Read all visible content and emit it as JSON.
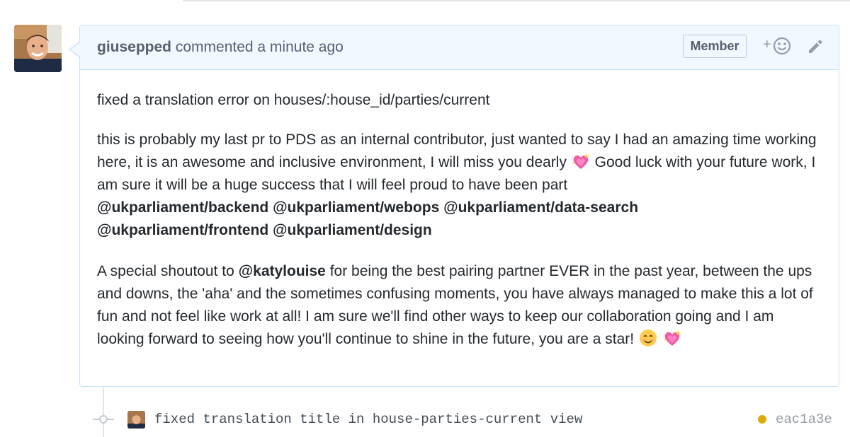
{
  "comment": {
    "author": "giusepped",
    "action": "commented",
    "timestamp": "a minute ago",
    "badge": "Member",
    "reaction_plus": "+",
    "paragraph1": "fixed a translation error on houses/:house_id/parties/current",
    "paragraph2": {
      "text_a": "this is probably my last pr to PDS as an internal contributor, just wanted to say I had an amazing time working here, it is an awesome and inclusive environment, I will miss you dearly",
      "text_b": "Good luck with your future work, I am sure it will be a huge success that I will feel proud to have been part",
      "mentions": [
        "@ukparliament/backend",
        "@ukparliament/webops",
        "@ukparliament/data-search",
        "@ukparliament/frontend",
        "@ukparliament/design"
      ]
    },
    "paragraph3": {
      "text_a": "A special shoutout to",
      "mention": "@katylouise",
      "text_b": "for being the best pairing partner EVER in the past year, between the ups and downs, the 'aha' and the sometimes confusing moments, you have always managed to make this a lot of fun and not feel like work at all! I am sure we'll find other ways to keep our collaboration going and I am looking forward to seeing how you'll continue to shine in the future, you are a star!"
    },
    "icons": {
      "emoji_heart": "sparkling-heart-icon",
      "emoji_smile": "smiling-face-icon",
      "reaction": "smiley-icon",
      "edit": "pencil-icon"
    }
  },
  "commit": {
    "message": "fixed translation title in house-parties-current view",
    "sha": "eac1a3e",
    "status_color": "#dbab09"
  },
  "colors": {
    "header_bg": "#f1f8ff",
    "border": "#c8e1ff",
    "text": "#24292e",
    "muted": "#586069"
  }
}
